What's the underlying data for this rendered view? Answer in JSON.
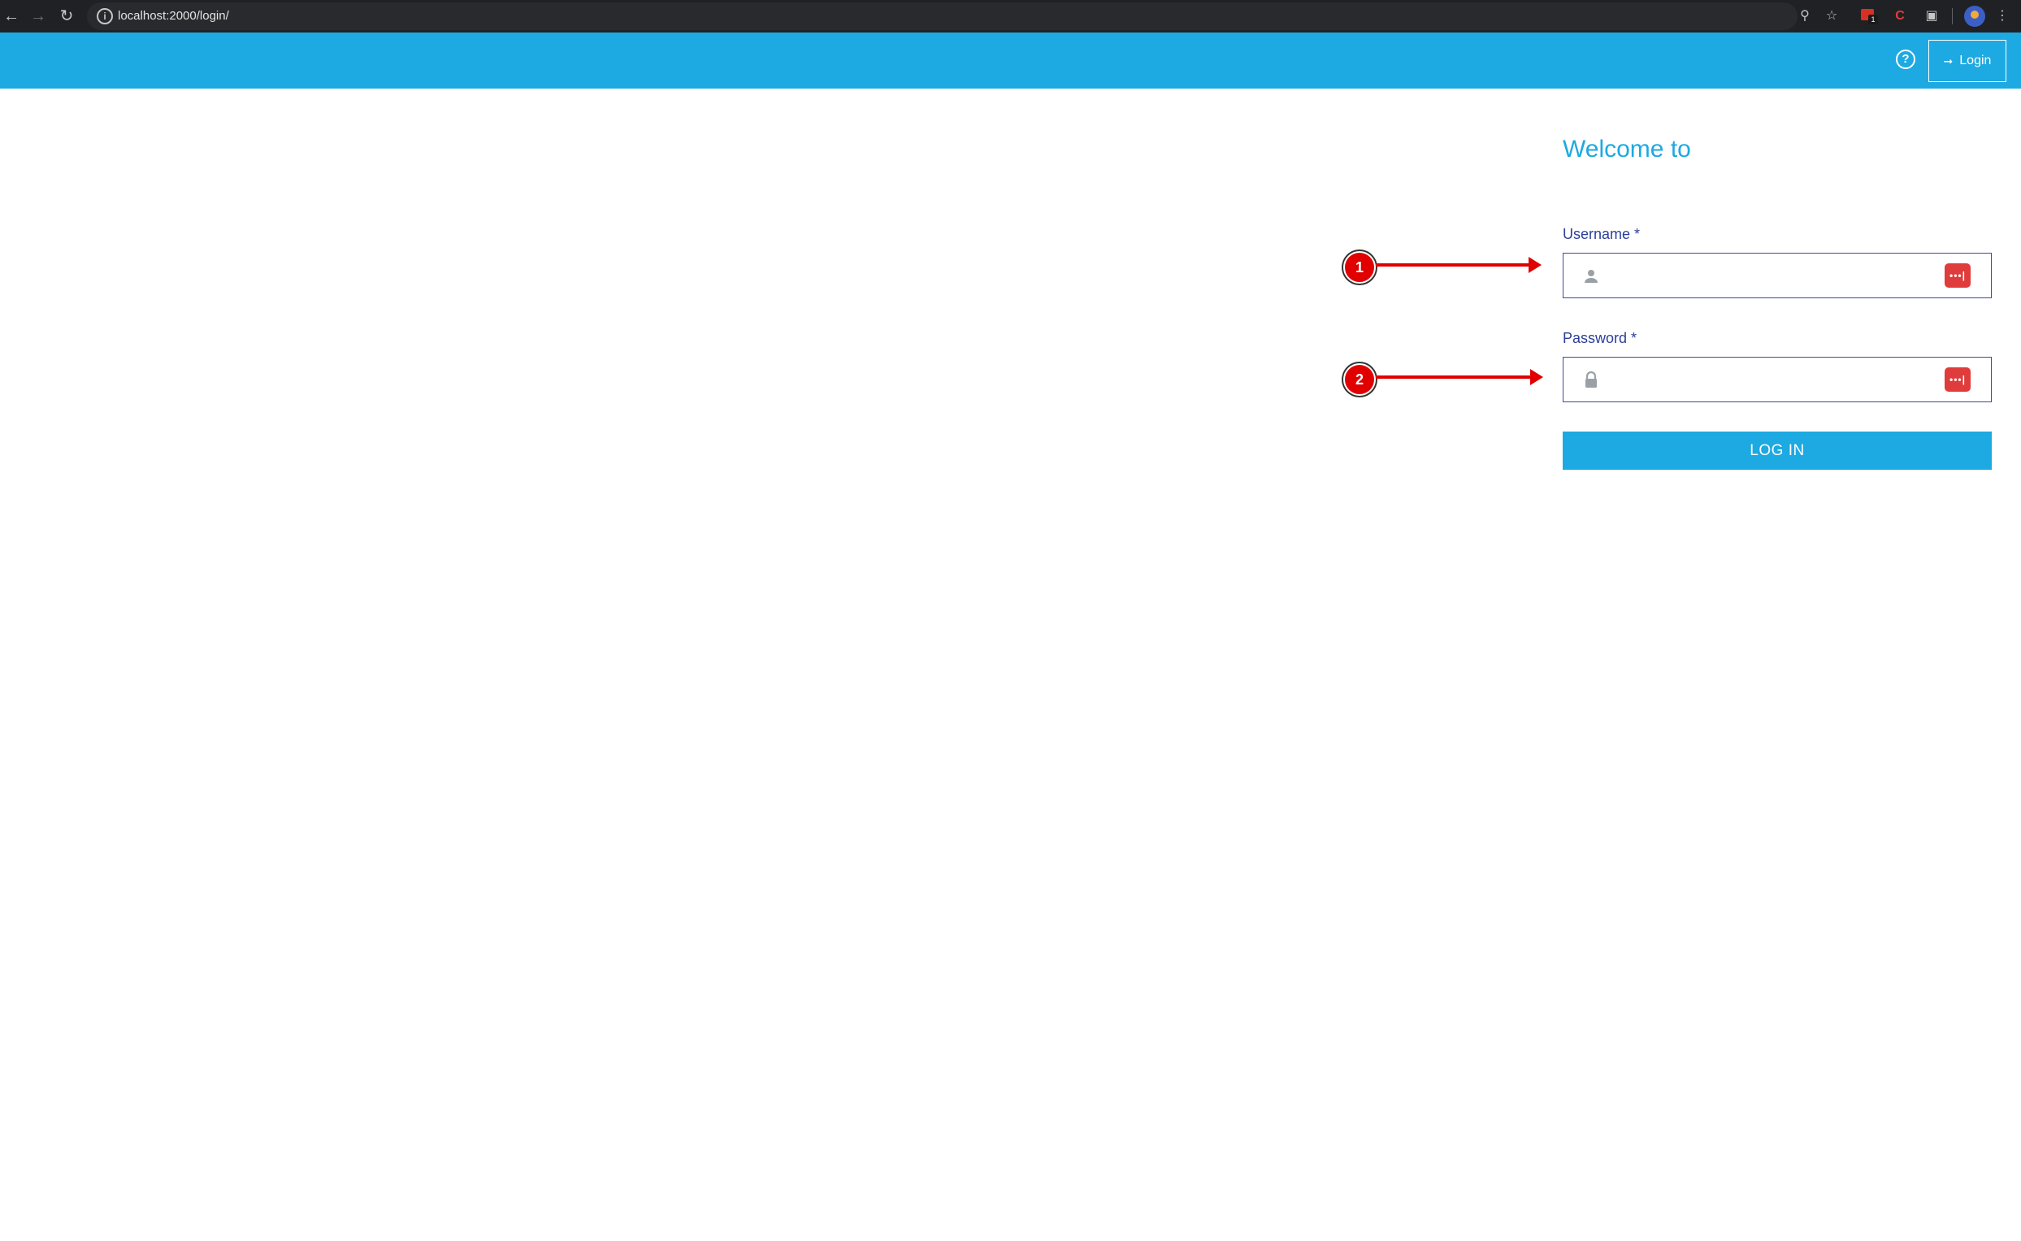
{
  "browser": {
    "url": "localhost:2000/login/",
    "back_icon": "arrow-left-icon",
    "forward_icon": "arrow-right-icon",
    "reload_icon": "reload-icon",
    "info_glyph": "i",
    "badge_count": "1"
  },
  "header": {
    "help_glyph": "?",
    "login_label": "Login",
    "background_color": "#1da9e1"
  },
  "login_form": {
    "title": "Welcome to",
    "username": {
      "label": "Username *",
      "value": "",
      "placeholder": ""
    },
    "password": {
      "label": "Password *",
      "value": "",
      "placeholder": ""
    },
    "password_manager_glyph": "•••|",
    "submit_label": "LOG IN"
  },
  "annotations": [
    {
      "number": "1"
    },
    {
      "number": "2"
    }
  ]
}
